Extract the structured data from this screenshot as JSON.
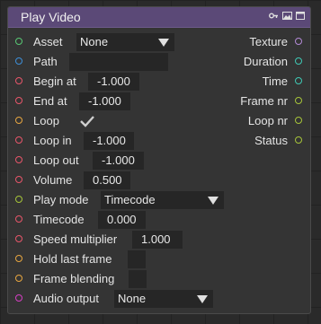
{
  "node": {
    "title": "Play Video",
    "icons": [
      "key-icon",
      "image-icon",
      "window-icon"
    ]
  },
  "inputs": {
    "asset": {
      "label": "Asset",
      "value": "None",
      "port_color": "#58c874"
    },
    "path": {
      "label": "Path",
      "value": "",
      "port_color": "#3d8fd9"
    },
    "begin_at": {
      "label": "Begin at",
      "value": "-1.000",
      "port_color": "#e8566a"
    },
    "end_at": {
      "label": "End at",
      "value": "-1.000",
      "port_color": "#e8566a"
    },
    "loop": {
      "label": "Loop",
      "checked": true,
      "port_color": "#e8a640"
    },
    "loop_in": {
      "label": "Loop in",
      "value": "-1.000",
      "port_color": "#e8566a"
    },
    "loop_out": {
      "label": "Loop out",
      "value": "-1.000",
      "port_color": "#e8566a"
    },
    "volume": {
      "label": "Volume",
      "value": "0.500",
      "port_color": "#e8566a"
    },
    "play_mode": {
      "label": "Play mode",
      "value": "Timecode",
      "port_color": "#a6c43a"
    },
    "timecode": {
      "label": "Timecode",
      "value": "0.000",
      "port_color": "#e8566a"
    },
    "speed_multiplier": {
      "label": "Speed multiplier",
      "value": "1.000",
      "port_color": "#e8566a"
    },
    "hold_last_frame": {
      "label": "Hold last frame",
      "value": "",
      "port_color": "#e8a640"
    },
    "frame_blending": {
      "label": "Frame blending",
      "value": "",
      "port_color": "#e8a640"
    },
    "audio_output": {
      "label": "Audio output",
      "value": "None",
      "port_color": "#d63fc4"
    }
  },
  "outputs": {
    "texture": {
      "label": "Texture",
      "port_color": "#b38ad6"
    },
    "duration": {
      "label": "Duration",
      "port_color": "#3fc9b5"
    },
    "time": {
      "label": "Time",
      "port_color": "#3fc9b5"
    },
    "frame_nr": {
      "label": "Frame nr",
      "port_color": "#a6c43a"
    },
    "loop_nr": {
      "label": "Loop nr",
      "port_color": "#a6c43a"
    },
    "status": {
      "label": "Status",
      "port_color": "#a6c43a"
    }
  }
}
